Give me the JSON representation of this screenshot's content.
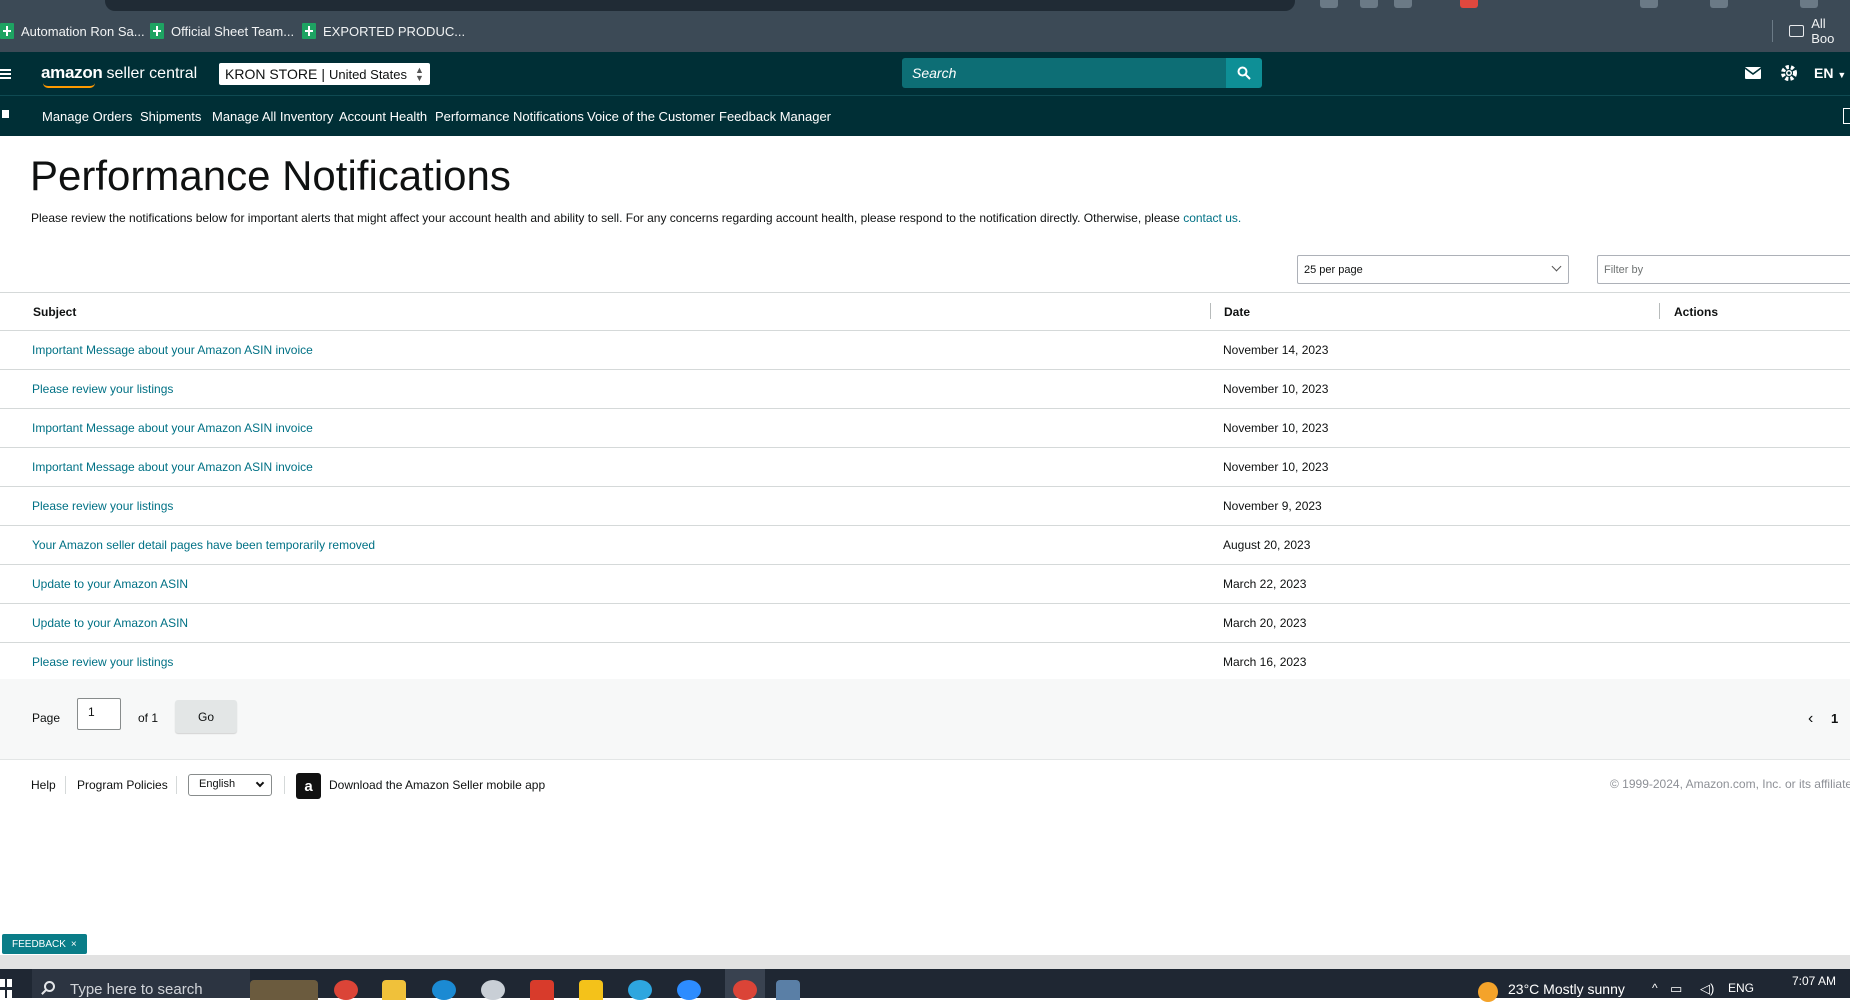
{
  "bookmarks": [
    {
      "label": "Automation Ron Sa..."
    },
    {
      "label": "Official Sheet Team..."
    },
    {
      "label": "EXPORTED PRODUC..."
    }
  ],
  "all_bookmarks_label": "All Boo",
  "header": {
    "logo_amazon": "amazon",
    "logo_seller_central": "seller central",
    "store_name": "KRON STORE",
    "store_separator": "|",
    "store_region": "United States",
    "search_placeholder": "Search",
    "language": "EN"
  },
  "nav": {
    "items": [
      {
        "label": "Manage Orders"
      },
      {
        "label": "Shipments"
      },
      {
        "label": "Manage All Inventory"
      },
      {
        "label": "Account Health"
      },
      {
        "label": "Performance Notifications"
      },
      {
        "label": "Voice of the Customer"
      },
      {
        "label": "Feedback Manager"
      }
    ]
  },
  "page": {
    "title": "Performance Notifications",
    "intro_text": "Please review the notifications below for important alerts that might affect your account health and ability to sell. For any concerns regarding account health, please respond to the notification directly. Otherwise, please ",
    "intro_link": "contact us."
  },
  "controls": {
    "per_page": "25 per page",
    "filter_placeholder": "Filter by"
  },
  "table": {
    "headers": {
      "subject": "Subject",
      "date": "Date",
      "actions": "Actions"
    },
    "rows": [
      {
        "subject": "Important Message about your Amazon ASIN invoice",
        "date": "November 14, 2023"
      },
      {
        "subject": "Please review your listings",
        "date": "November 10, 2023"
      },
      {
        "subject": "Important Message about your Amazon ASIN invoice",
        "date": "November 10, 2023"
      },
      {
        "subject": "Important Message about your Amazon ASIN invoice",
        "date": "November 10, 2023"
      },
      {
        "subject": "Please review your listings",
        "date": "November 9, 2023"
      },
      {
        "subject": "Your Amazon seller detail pages have been temporarily removed",
        "date": "August 20, 2023"
      },
      {
        "subject": "Update to your Amazon ASIN",
        "date": "March 22, 2023"
      },
      {
        "subject": "Update to your Amazon ASIN",
        "date": "March 20, 2023"
      },
      {
        "subject": "Please review your listings",
        "date": "March 16, 2023"
      }
    ]
  },
  "pagination": {
    "page_label": "Page",
    "page_value": "1",
    "of_label": "of 1",
    "go_label": "Go",
    "prev_glyph": "‹",
    "current_page": "1"
  },
  "footer": {
    "help": "Help",
    "program_policies": "Program Policies",
    "language_select": "English",
    "app_icon_letter": "a",
    "download_app": "Download the Amazon Seller mobile app",
    "copyright": "© 1999-2024, Amazon.com, Inc. or its affiliate"
  },
  "feedback": {
    "label": "FEEDBACK",
    "close": "×"
  },
  "taskbar": {
    "search_placeholder": "Type here to search",
    "weather": "23°C  Mostly sunny",
    "language": "ENG",
    "time": "7:07 AM"
  },
  "colors": {
    "header_bg": "#002f36",
    "link": "#007185",
    "search_btn": "#0e8f96",
    "feedback_bg": "#0a7d88"
  }
}
